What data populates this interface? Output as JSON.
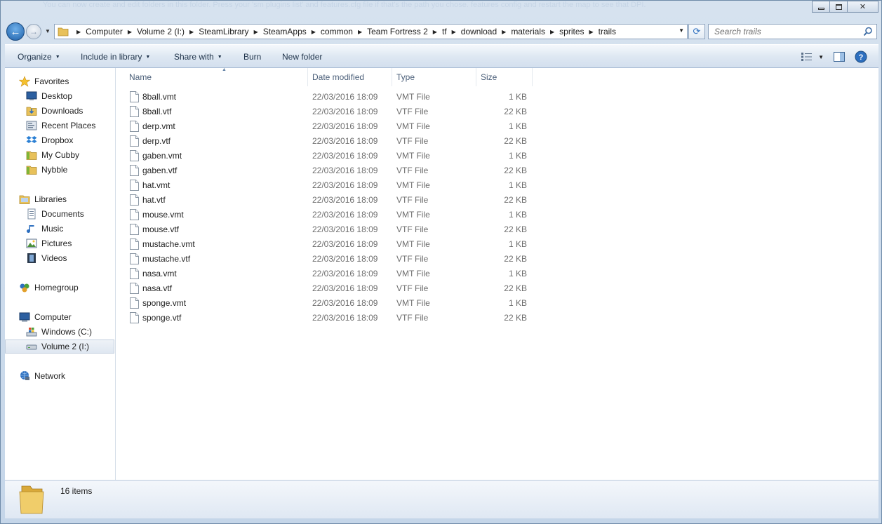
{
  "window": {
    "background_text": "You can now create and edit folders in this folder. Press your 'sm plugins list' and features.cfg file if that's the path you chose. features config and restart the map to see that DPI."
  },
  "address": {
    "crumbs": [
      "Computer",
      "Volume 2 (I:)",
      "SteamLibrary",
      "SteamApps",
      "common",
      "Team Fortress 2",
      "tf",
      "download",
      "materials",
      "sprites",
      "trails"
    ]
  },
  "search": {
    "placeholder": "Search trails"
  },
  "toolbar": {
    "organize": "Organize",
    "include_in_library": "Include in library",
    "share_with": "Share with",
    "burn": "Burn",
    "new_folder": "New folder"
  },
  "nav": {
    "favorites": {
      "label": "Favorites",
      "items": [
        "Desktop",
        "Downloads",
        "Recent Places",
        "Dropbox",
        "My Cubby",
        "Nybble"
      ]
    },
    "libraries": {
      "label": "Libraries",
      "items": [
        "Documents",
        "Music",
        "Pictures",
        "Videos"
      ]
    },
    "homegroup": "Homegroup",
    "computer": {
      "label": "Computer",
      "items": [
        "Windows (C:)",
        "Volume 2 (I:)"
      ]
    },
    "network": "Network"
  },
  "columns": {
    "name": "Name",
    "date": "Date modified",
    "type": "Type",
    "size": "Size"
  },
  "files": [
    {
      "name": "8ball.vmt",
      "date": "22/03/2016 18:09",
      "type": "VMT File",
      "size": "1 KB"
    },
    {
      "name": "8ball.vtf",
      "date": "22/03/2016 18:09",
      "type": "VTF File",
      "size": "22 KB"
    },
    {
      "name": "derp.vmt",
      "date": "22/03/2016 18:09",
      "type": "VMT File",
      "size": "1 KB"
    },
    {
      "name": "derp.vtf",
      "date": "22/03/2016 18:09",
      "type": "VTF File",
      "size": "22 KB"
    },
    {
      "name": "gaben.vmt",
      "date": "22/03/2016 18:09",
      "type": "VMT File",
      "size": "1 KB"
    },
    {
      "name": "gaben.vtf",
      "date": "22/03/2016 18:09",
      "type": "VTF File",
      "size": "22 KB"
    },
    {
      "name": "hat.vmt",
      "date": "22/03/2016 18:09",
      "type": "VMT File",
      "size": "1 KB"
    },
    {
      "name": "hat.vtf",
      "date": "22/03/2016 18:09",
      "type": "VTF File",
      "size": "22 KB"
    },
    {
      "name": "mouse.vmt",
      "date": "22/03/2016 18:09",
      "type": "VMT File",
      "size": "1 KB"
    },
    {
      "name": "mouse.vtf",
      "date": "22/03/2016 18:09",
      "type": "VTF File",
      "size": "22 KB"
    },
    {
      "name": "mustache.vmt",
      "date": "22/03/2016 18:09",
      "type": "VMT File",
      "size": "1 KB"
    },
    {
      "name": "mustache.vtf",
      "date": "22/03/2016 18:09",
      "type": "VTF File",
      "size": "22 KB"
    },
    {
      "name": "nasa.vmt",
      "date": "22/03/2016 18:09",
      "type": "VMT File",
      "size": "1 KB"
    },
    {
      "name": "nasa.vtf",
      "date": "22/03/2016 18:09",
      "type": "VTF File",
      "size": "22 KB"
    },
    {
      "name": "sponge.vmt",
      "date": "22/03/2016 18:09",
      "type": "VMT File",
      "size": "1 KB"
    },
    {
      "name": "sponge.vtf",
      "date": "22/03/2016 18:09",
      "type": "VTF File",
      "size": "22 KB"
    }
  ],
  "status": {
    "item_count": "16 items"
  },
  "colors": {
    "accent": "#2d6fbf",
    "selection": "#dfe7f1",
    "folder": "#e8c15a"
  }
}
